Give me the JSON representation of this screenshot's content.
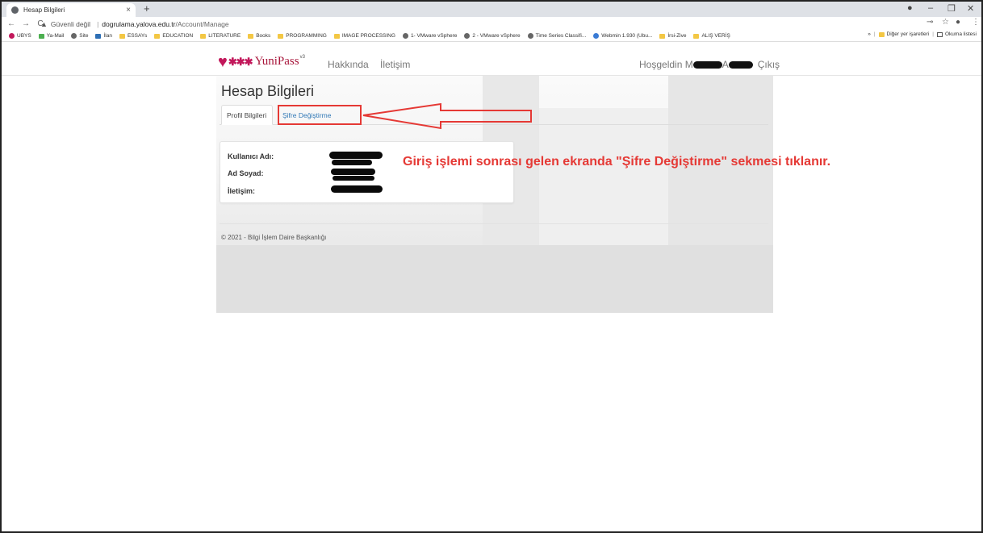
{
  "browser": {
    "tab_title": "Hesap Bilgileri",
    "security_label": "Güvenli değil",
    "url_host": "dogrulama.yalova.edu.tr",
    "url_path": "/Account/Manage",
    "bookmarks": [
      "UBYS",
      "Ya-Mail",
      "Site",
      "İlan",
      "ESSAYs",
      "EDUCATION",
      "LITERATURE",
      "Books",
      "PROGRAMMING",
      "IMAGE PROCESSING",
      "1- VMware vSphere",
      "2 - VMware vSphere",
      "Time Series Classifi...",
      "Webmin 1.930 (Ubu...",
      "İrsi-Zive",
      "ALIŞ VERİŞ"
    ],
    "bookmark_icons": [
      "yuni-icon",
      "microsoft-icon",
      "globe-icon",
      "car-icon",
      "folder-icon",
      "folder-icon",
      "folder-icon",
      "folder-icon",
      "folder-icon",
      "folder-icon",
      "globe-icon",
      "globe-icon",
      "globe-icon",
      "webmin-icon",
      "folder-icon",
      "folder-icon"
    ],
    "overflow_label": "»",
    "other_bookmarks": "Diğer yer işaretleri",
    "reading_list": "Okuma listesi"
  },
  "site": {
    "logo_stars": "✱✱✱",
    "logo_name": "YuniPass",
    "logo_version": "v3",
    "nav": [
      "Hakkında",
      "İletişim"
    ],
    "welcome_prefix": "Hoşgeldin M",
    "welcome_mid": "A",
    "logout": "Çıkış"
  },
  "page": {
    "title": "Hesap Bilgileri",
    "tabs": [
      "Profil Bilgileri",
      "Şifre Değiştirme"
    ],
    "fields": [
      "Kullanıcı Adı:",
      "Ad Soyad:",
      "İletişim:"
    ],
    "annotation": "Giriş işlemi sonrası gelen ekranda \"Şifre Değiştirme\" sekmesi tıklanır.",
    "footer": "© 2021 - Bilgi İşlem Daire Başkanlığı"
  },
  "colors": {
    "annotation": "#e53935",
    "link": "#337ab7",
    "brand": "#c2185b"
  }
}
